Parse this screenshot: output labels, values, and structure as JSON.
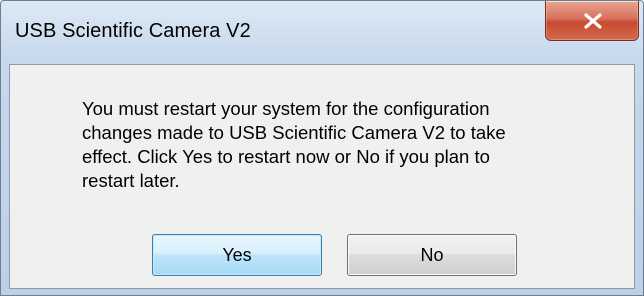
{
  "window": {
    "title": "USB Scientific Camera V2",
    "close_icon": "close-icon"
  },
  "dialog": {
    "message": "You must restart your system for the configuration\nchanges made to USB Scientific Camera V2 to take\neffect. Click Yes to restart now or No if you plan to\nrestart later.",
    "yes_label": "Yes",
    "no_label": "No",
    "default_button": "Yes"
  },
  "colors": {
    "close_button": "#c74a30",
    "default_button_border": "#3c7fb1",
    "client_background": "#f0f0f0"
  }
}
